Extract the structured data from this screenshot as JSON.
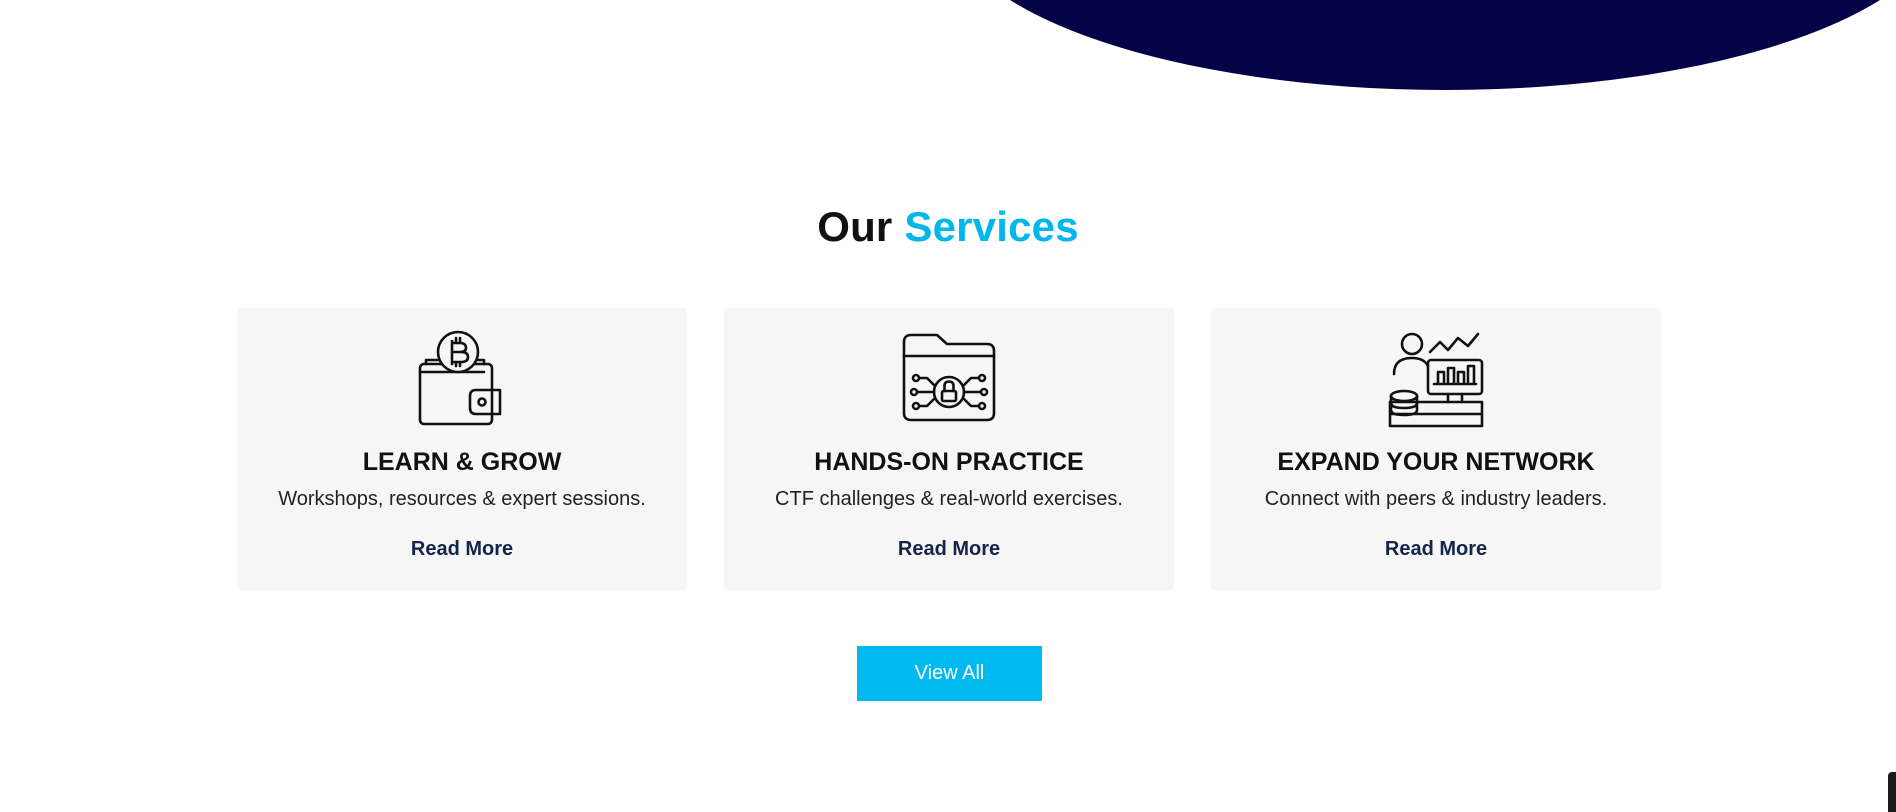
{
  "heading": {
    "prefix": "Our",
    "accent": "Services"
  },
  "services": [
    {
      "icon": "bitcoin-wallet-icon",
      "title": "LEARN & GROW",
      "description": "Workshops, resources & expert sessions.",
      "link_label": "Read More"
    },
    {
      "icon": "secure-folder-icon",
      "title": "HANDS-ON PRACTICE",
      "description": "CTF challenges & real-world exercises.",
      "link_label": "Read More"
    },
    {
      "icon": "analyst-dashboard-icon",
      "title": "EXPAND YOUR NETWORK",
      "description": "Connect with peers & industry leaders.",
      "link_label": "Read More"
    }
  ],
  "view_all_label": "View All",
  "colors": {
    "accent": "#00b6eb",
    "button": "#00b9ef",
    "wave": "#050347",
    "card_bg": "#f6f6f6",
    "link": "#14254a"
  }
}
